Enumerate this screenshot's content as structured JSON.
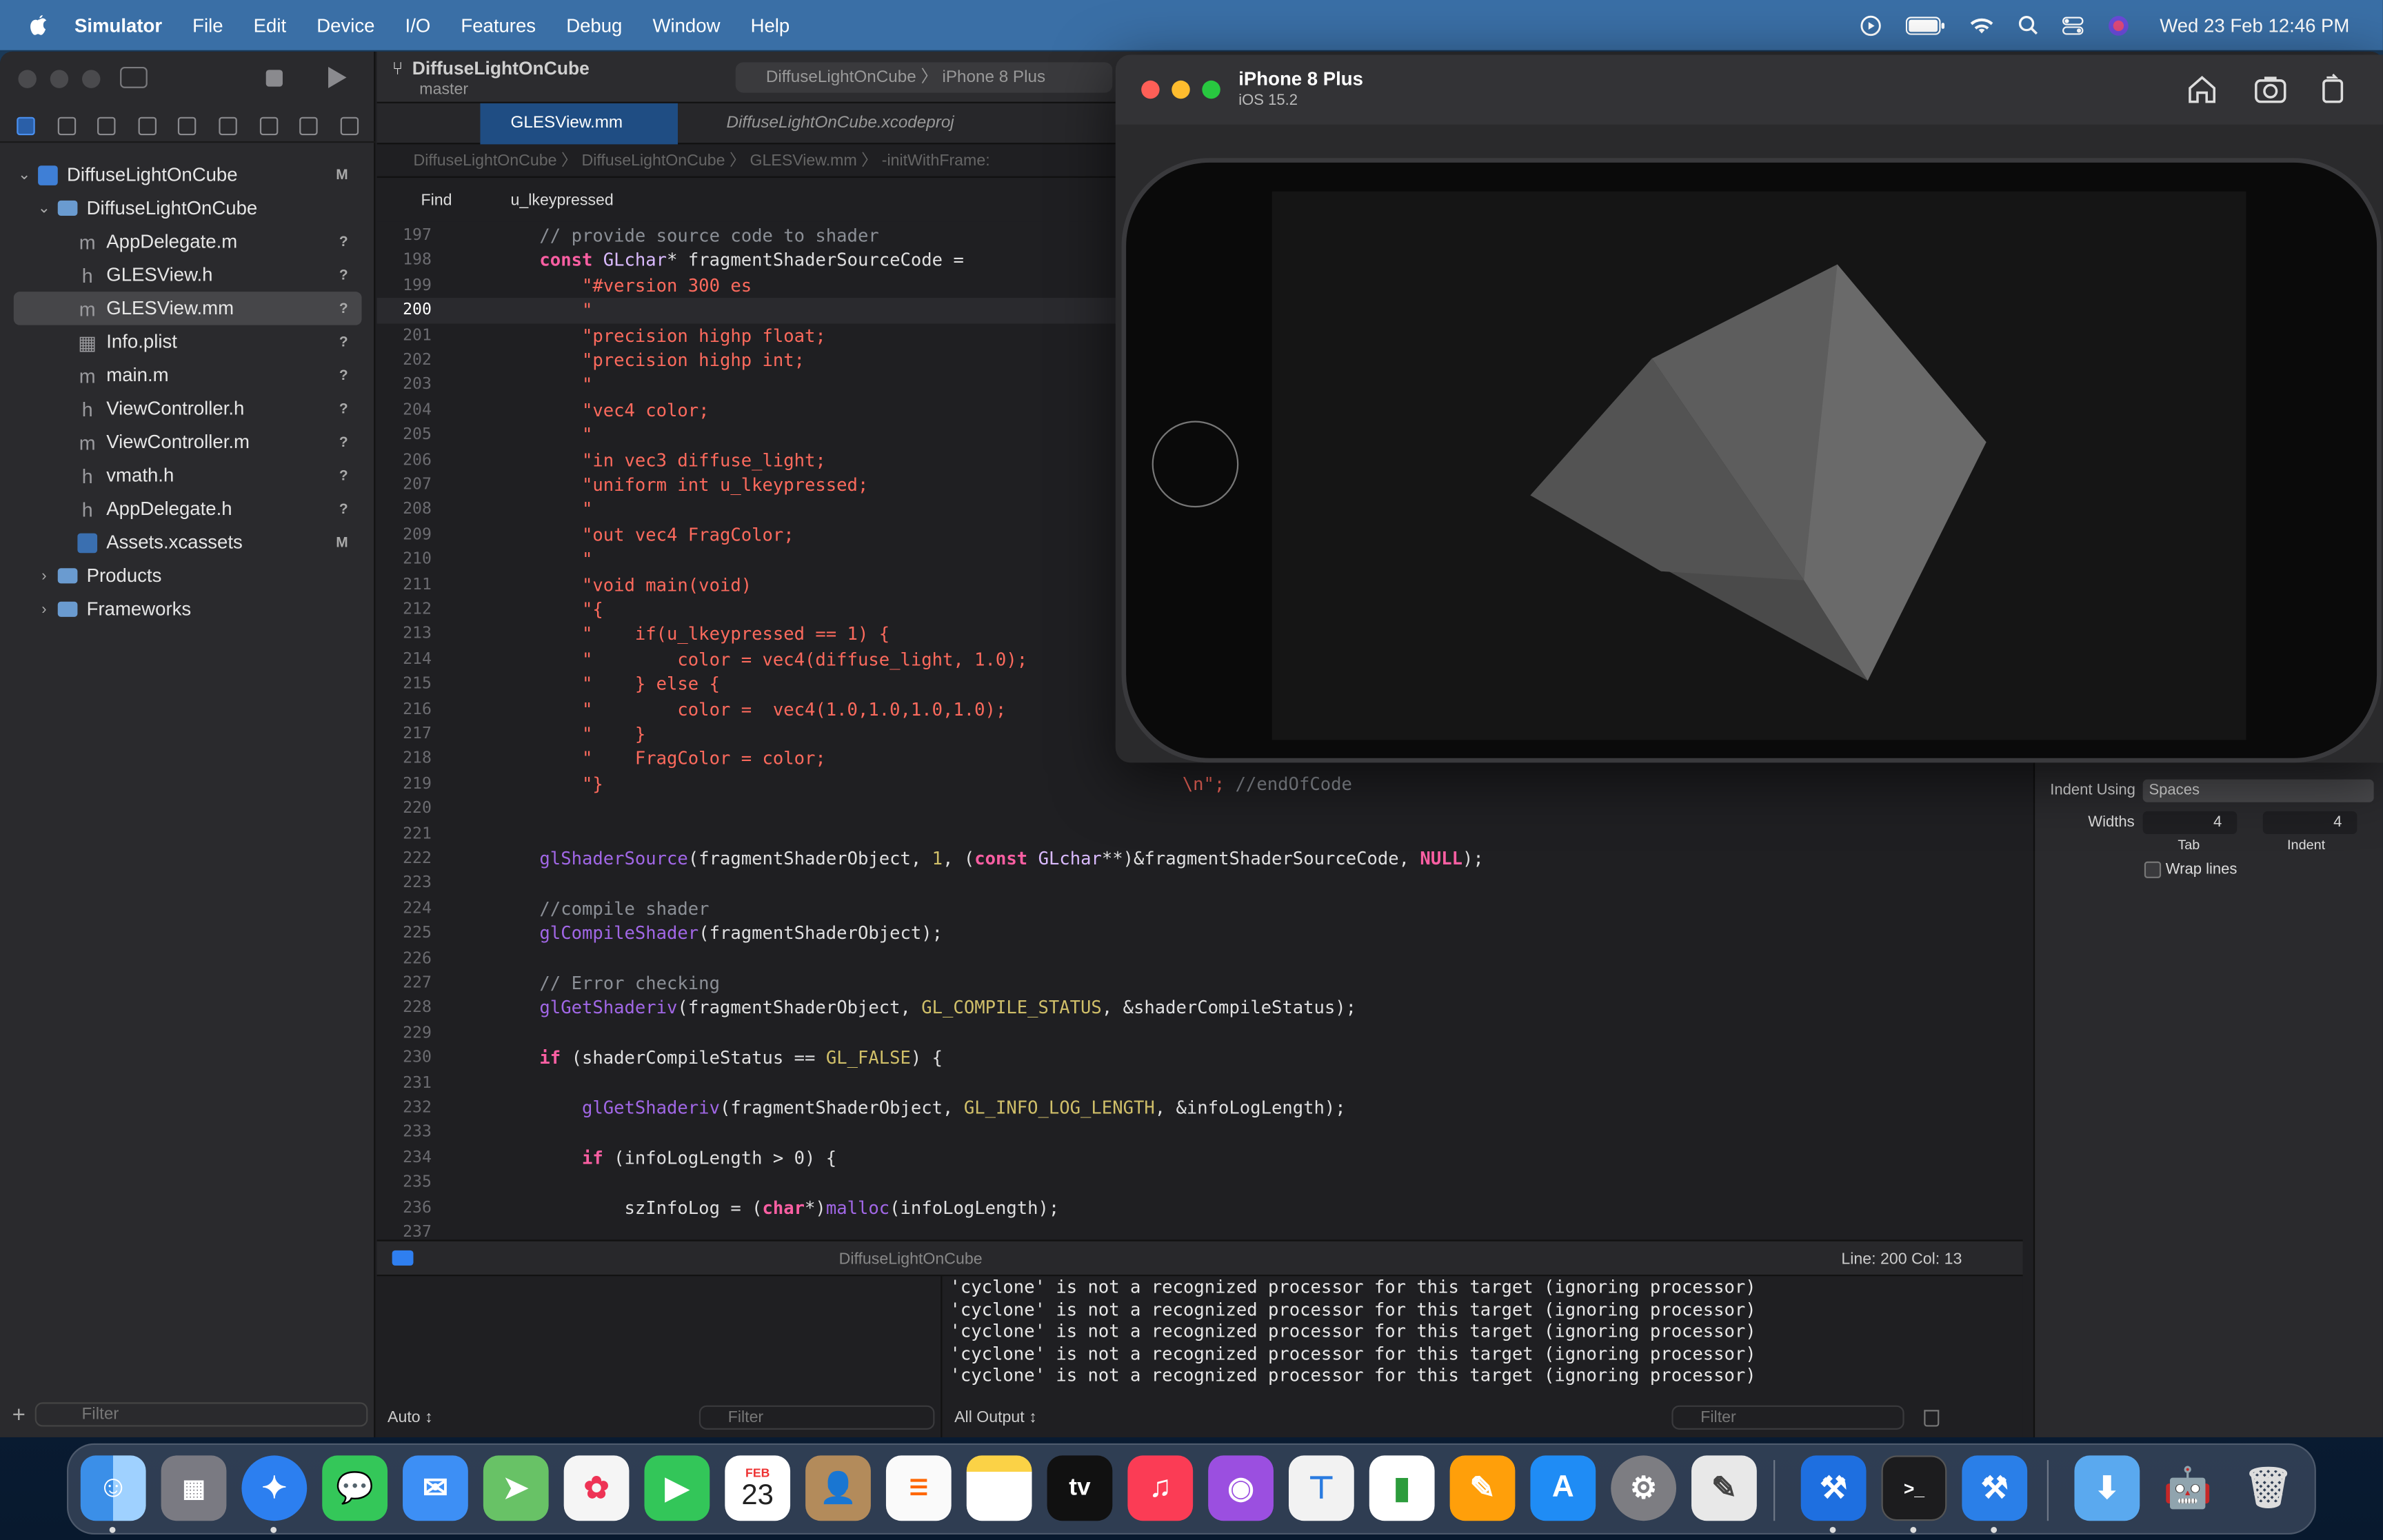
{
  "menubar": {
    "app": "Simulator",
    "items": [
      "File",
      "Edit",
      "Device",
      "I/O",
      "Features",
      "Debug",
      "Window",
      "Help"
    ],
    "clock": "Wed 23 Feb  12:46 PM"
  },
  "toolbar": {
    "project": "DiffuseLightOnCube",
    "branch": "master",
    "scheme": "DiffuseLightOnCube",
    "destination": "iPhone 8 Plus"
  },
  "navigator": {
    "root": {
      "label": "DiffuseLightOnCube",
      "status": "M"
    },
    "group": {
      "label": "DiffuseLightOnCube"
    },
    "files": [
      {
        "label": "AppDelegate.m",
        "status": "?",
        "kind": "m"
      },
      {
        "label": "GLESView.h",
        "status": "?",
        "kind": "h"
      },
      {
        "label": "GLESView.mm",
        "status": "?",
        "kind": "m"
      },
      {
        "label": "Info.plist",
        "status": "?",
        "kind": "plist"
      },
      {
        "label": "main.m",
        "status": "?",
        "kind": "m"
      },
      {
        "label": "ViewController.h",
        "status": "?",
        "kind": "h"
      },
      {
        "label": "ViewController.m",
        "status": "?",
        "kind": "m"
      },
      {
        "label": "vmath.h",
        "status": "?",
        "kind": "h"
      },
      {
        "label": "AppDelegate.h",
        "status": "?",
        "kind": "h"
      },
      {
        "label": "Assets.xcassets",
        "status": "M",
        "kind": "assets"
      }
    ],
    "folders": [
      "Products",
      "Frameworks"
    ],
    "filter_placeholder": "Filter"
  },
  "tabs": {
    "active": "GLESView.mm",
    "inactive": "DiffuseLightOnCube.xcodeproj"
  },
  "jumpbar": {
    "path": [
      "DiffuseLightOnCube",
      "DiffuseLightOnCube",
      "GLESView.mm",
      "-initWithFrame:"
    ]
  },
  "find": {
    "mode": "Find",
    "query": "u_lkeypressed"
  },
  "code": {
    "current_line": "200",
    "lines": [
      {
        "n": "197",
        "t": "        // provide source code to shader"
      },
      {
        "n": "198",
        "t": "        const GLchar* fragmentShaderSourceCode ="
      },
      {
        "n": "199",
        "t": "            \"#version 300 es"
      },
      {
        "n": "200",
        "t": "            \""
      },
      {
        "n": "201",
        "t": "            \"precision highp float;"
      },
      {
        "n": "202",
        "t": "            \"precision highp int;"
      },
      {
        "n": "203",
        "t": "            \""
      },
      {
        "n": "204",
        "t": "            \"vec4 color;"
      },
      {
        "n": "205",
        "t": "            \""
      },
      {
        "n": "206",
        "t": "            \"in vec3 diffuse_light;"
      },
      {
        "n": "207",
        "t": "            \"uniform int u_lkeypressed;"
      },
      {
        "n": "208",
        "t": "            \""
      },
      {
        "n": "209",
        "t": "            \"out vec4 FragColor;"
      },
      {
        "n": "210",
        "t": "            \""
      },
      {
        "n": "211",
        "t": "            \"void main(void)"
      },
      {
        "n": "212",
        "t": "            \"{"
      },
      {
        "n": "213",
        "t": "            \"    if(u_lkeypressed == 1) {"
      },
      {
        "n": "214",
        "t": "            \"        color = vec4(diffuse_light, 1.0);"
      },
      {
        "n": "215",
        "t": "            \"    } else {"
      },
      {
        "n": "216",
        "t": "            \"        color =  vec4(1.0,1.0,1.0,1.0);"
      },
      {
        "n": "217",
        "t": "            \"    }"
      },
      {
        "n": "218",
        "t": "            \"    FragColor = color;"
      },
      {
        "n": "219",
        "t": "            \"}"
      },
      {
        "n": "220",
        "t": ""
      },
      {
        "n": "221",
        "t": ""
      },
      {
        "n": "222",
        "t": "        glShaderSource(fragmentShaderObject, 1, (const GLchar**)&fragmentShaderSourceCode, NULL);"
      },
      {
        "n": "223",
        "t": ""
      },
      {
        "n": "224",
        "t": "        //compile shader"
      },
      {
        "n": "225",
        "t": "        glCompileShader(fragmentShaderObject);"
      },
      {
        "n": "226",
        "t": ""
      },
      {
        "n": "227",
        "t": "        // Error checking"
      },
      {
        "n": "228",
        "t": "        glGetShaderiv(fragmentShaderObject, GL_COMPILE_STATUS, &shaderCompileStatus);"
      },
      {
        "n": "229",
        "t": ""
      },
      {
        "n": "230",
        "t": "        if (shaderCompileStatus == GL_FALSE) {"
      },
      {
        "n": "231",
        "t": ""
      },
      {
        "n": "232",
        "t": "            glGetShaderiv(fragmentShaderObject, GL_INFO_LOG_LENGTH, &infoLogLength);"
      },
      {
        "n": "233",
        "t": ""
      },
      {
        "n": "234",
        "t": "            if (infoLogLength > 0) {"
      },
      {
        "n": "235",
        "t": ""
      },
      {
        "n": "236",
        "t": "                szInfoLog = (char*)malloc(infoLogLength);"
      },
      {
        "n": "237",
        "t": ""
      }
    ],
    "line219_tail": "\\n\"; //endOfCode"
  },
  "debugbar": {
    "process": "DiffuseLightOnCube",
    "position": "Line: 200  Col: 13"
  },
  "console": {
    "lines": [
      "'cyclone' is not a recognized processor for this target (ignoring processor)",
      "'cyclone' is not a recognized processor for this target (ignoring processor)",
      "'cyclone' is not a recognized processor for this target (ignoring processor)",
      "'cyclone' is not a recognized processor for this target (ignoring processor)",
      "'cyclone' is not a recognized processor for this target (ignoring processor)"
    ],
    "vars_mode": "Auto ↕",
    "output_mode": "All Output ↕",
    "filter_placeholder": "Filter"
  },
  "inspector": {
    "indent_using_label": "Indent Using",
    "indent_using_value": "Spaces",
    "widths_label": "Widths",
    "tab_width": "4",
    "indent_width": "4",
    "tab_label": "Tab",
    "indent_label": "Indent",
    "wrap_lines_label": "Wrap lines"
  },
  "simulator": {
    "device": "iPhone 8 Plus",
    "os": "iOS 15.2"
  },
  "dock": {
    "calendar_month": "FEB",
    "calendar_day": "23",
    "tv_label": "tv"
  },
  "colors": {
    "keyword": "#fc5fa3",
    "string": "#fc6a5d",
    "comment": "#8b8f96",
    "function": "#a167e6",
    "constant": "#d0bf69",
    "accent": "#2f7ff0"
  }
}
